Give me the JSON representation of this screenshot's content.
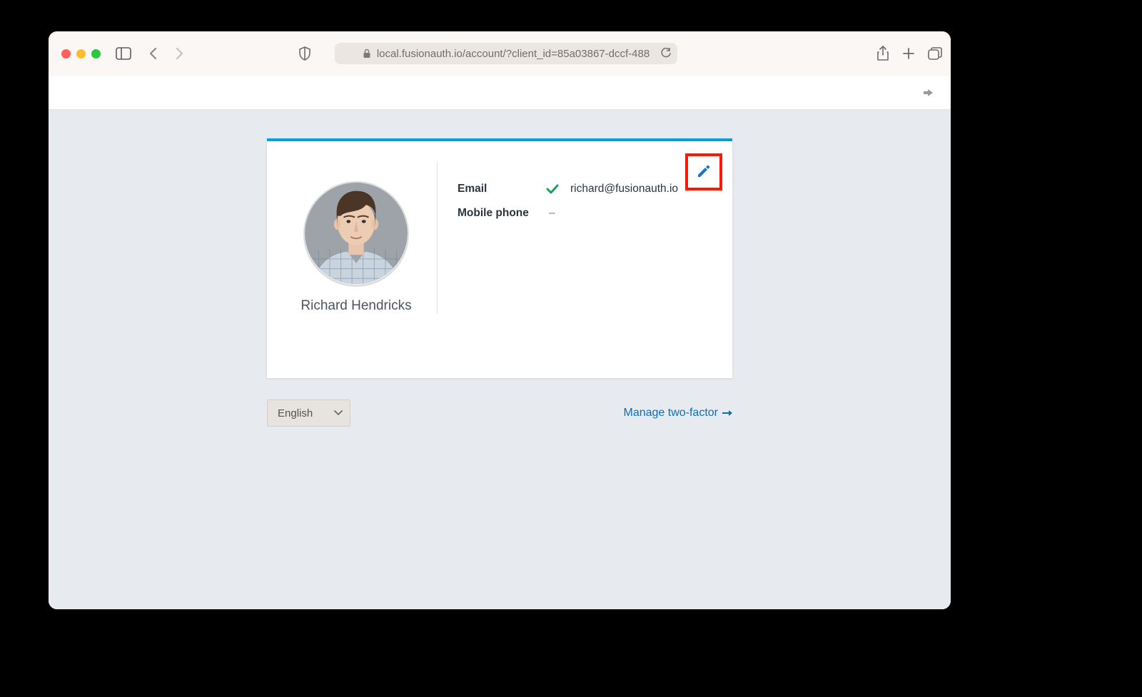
{
  "browser": {
    "url": "local.fusionauth.io/account/?client_id=85a03867-dccf-488"
  },
  "profile": {
    "display_name": "Richard Hendricks",
    "fields": {
      "email_label": "Email",
      "email_value": "richard@fusionauth.io",
      "email_verified": true,
      "mobile_label": "Mobile phone",
      "mobile_value": "–"
    }
  },
  "language_selector": {
    "selected": "English"
  },
  "links": {
    "manage_2fa": "Manage two-factor"
  },
  "colors": {
    "accent": "#0d9ddb",
    "link": "#0a6fb6",
    "highlight": "#ff1800"
  }
}
